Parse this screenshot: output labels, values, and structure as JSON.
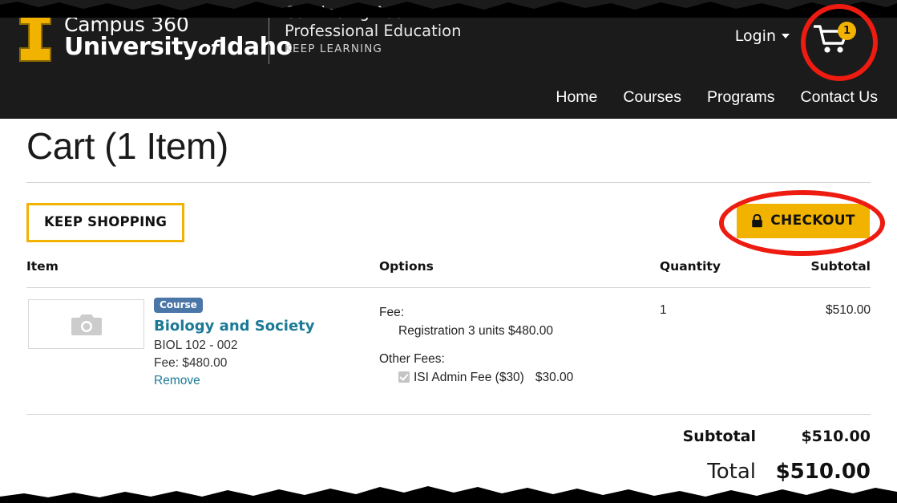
{
  "header": {
    "brand": {
      "logo_icon": "university-of-idaho-i-logo",
      "campus": "Campus 360",
      "university": "University",
      "of": "of",
      "idaho": "Idaho",
      "tagline_line1": "Continuing Adult",
      "tagline_line2": "Professional Education",
      "tagline_line3": "KEEP LEARNING"
    },
    "login_label": "Login",
    "cart": {
      "icon": "shopping-cart-icon",
      "badge_count": "1"
    },
    "nav": [
      {
        "label": "Home"
      },
      {
        "label": "Courses"
      },
      {
        "label": "Programs"
      },
      {
        "label": "Contact Us"
      }
    ]
  },
  "main": {
    "page_title": "Cart (1 Item)",
    "keep_shopping_label": "KEEP SHOPPING",
    "checkout_label": "CHECKOUT",
    "checkout_icon": "lock-icon",
    "table": {
      "columns": {
        "item": "Item",
        "options": "Options",
        "quantity": "Quantity",
        "subtotal": "Subtotal"
      },
      "rows": [
        {
          "thumbnail_icon": "camera-placeholder-icon",
          "badge": "Course",
          "title": "Biology and Society",
          "code": "BIOL 102 - 002",
          "fee": "Fee: $480.00",
          "remove_label": "Remove",
          "options": {
            "fee_label": "Fee:",
            "fee_line": "Registration  3 units  $480.00",
            "other_fees_label": "Other Fees:",
            "other_fee_name": "ISI Admin Fee ($30)",
            "other_fee_amount": "$30.00",
            "other_fee_checked": true
          },
          "quantity": "1",
          "subtotal": "$510.00"
        }
      ]
    },
    "totals": {
      "subtotal_label": "Subtotal",
      "subtotal_value": "$510.00",
      "total_label": "Total",
      "total_value": "$510.00"
    }
  },
  "annotations": {
    "color": "#ee1b11",
    "targets": [
      "cart-icon",
      "checkout-button"
    ]
  },
  "colors": {
    "header_bg": "#1b1b1b",
    "brand_gold": "#f1b300",
    "link_teal": "#1b7a96",
    "badge_blue": "#4a76a8",
    "annotation_red": "#ee1b11"
  }
}
